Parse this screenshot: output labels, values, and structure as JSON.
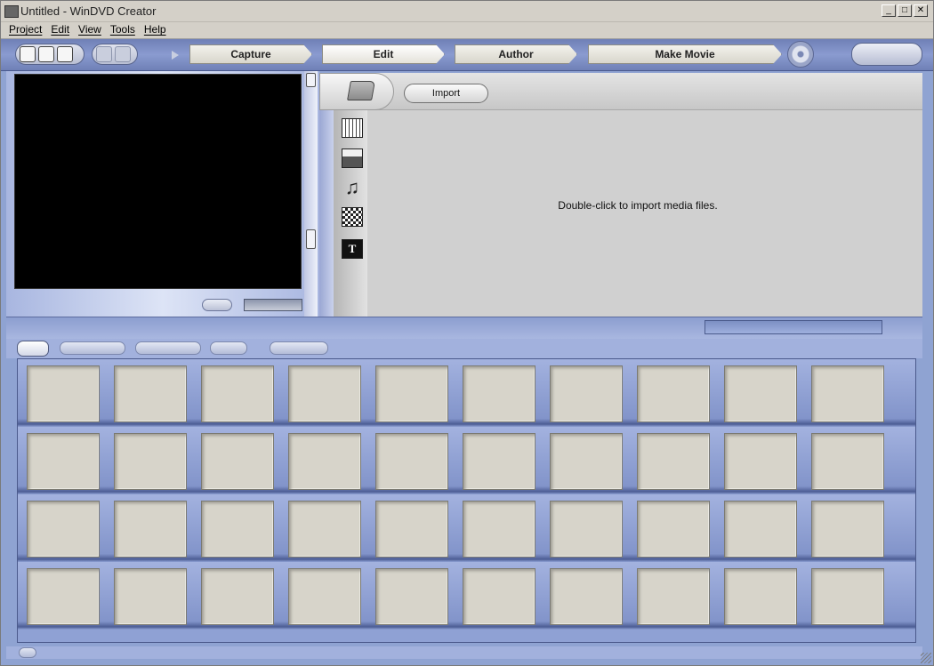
{
  "window": {
    "title": "Untitled - WinDVD Creator"
  },
  "window_controls": {
    "minimize": "_",
    "maximize": "□",
    "close": "✕"
  },
  "menu": [
    "Project",
    "Edit",
    "View",
    "Tools",
    "Help"
  ],
  "steps": [
    "Capture",
    "Edit",
    "Author",
    "Make Movie"
  ],
  "active_step": "Edit",
  "library": {
    "import_label": "Import",
    "empty_message": "Double-click to import media files.",
    "category_icons": [
      "film-strip-icon",
      "image-icon",
      "music-note-icon",
      "transition-icon",
      "title-text-icon"
    ],
    "title_icon_glyph": "T",
    "audio_glyph": "♫"
  },
  "storyboard": {
    "rows": 4,
    "slots_per_row": 10
  },
  "colors": {
    "accent": "#8fa1d4",
    "slot": "#d7d4ca"
  }
}
